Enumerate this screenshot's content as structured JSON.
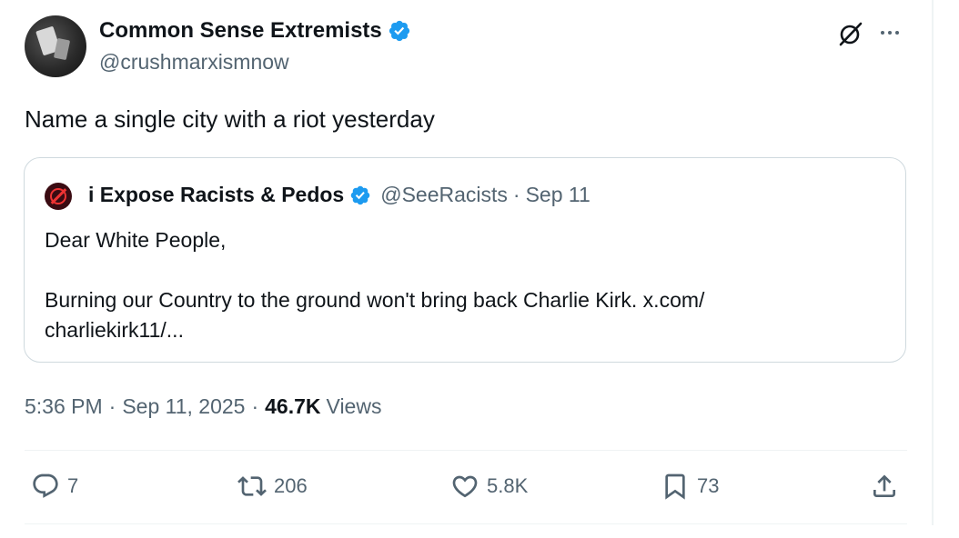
{
  "author": {
    "display_name": "Common Sense Extremists",
    "handle": "@crushmarxismnow",
    "verified": true
  },
  "tweet": {
    "text": "Name a single city with a riot yesterday",
    "time": "5:36 PM",
    "date": "Sep 11, 2025",
    "separator": "·",
    "views_count": "46.7K",
    "views_label": "Views"
  },
  "quote": {
    "display_name": "i Expose Racists & Pedos",
    "handle": "@SeeRacists",
    "separator": "·",
    "date": "Sep 11",
    "line1": "Dear White People,",
    "line2": "Burning our Country to the ground won't bring back Charlie Kirk. x.com/",
    "line3": "charliekirk11/..."
  },
  "actions": {
    "replies": "7",
    "reposts": "206",
    "likes": "5.8K",
    "bookmarks": "73"
  },
  "icons": {
    "verified": "verified-badge-icon",
    "grok": "grok-icon",
    "more": "more-options-icon",
    "reply": "reply-icon",
    "repost": "repost-icon",
    "like": "heart-icon",
    "bookmark": "bookmark-icon",
    "share": "share-icon"
  },
  "colors": {
    "verified_blue": "#1d9bf0",
    "text_primary": "#0f1419",
    "text_secondary": "#536471",
    "border": "#cfd9de"
  }
}
